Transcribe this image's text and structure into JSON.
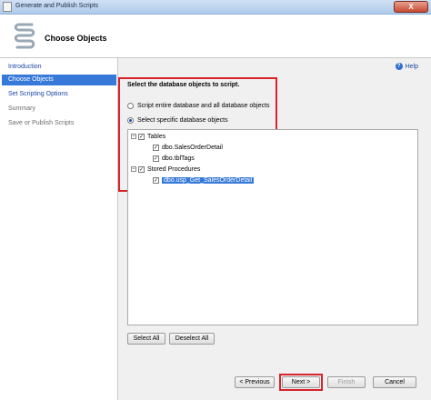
{
  "window": {
    "title": "Generate and Publish Scripts",
    "close_symbol": "X"
  },
  "header": {
    "page_title": "Choose Objects"
  },
  "sidebar": {
    "items": [
      {
        "label": "Introduction",
        "state": "link"
      },
      {
        "label": "Choose Objects",
        "state": "selected"
      },
      {
        "label": "Set Scripting Options",
        "state": "link"
      },
      {
        "label": "Summary",
        "state": "disabled"
      },
      {
        "label": "Save or Publish Scripts",
        "state": "disabled"
      }
    ]
  },
  "main": {
    "help_label": "Help",
    "help_icon_glyph": "?",
    "prompt": "Select the database objects to script.",
    "options": [
      {
        "label": "Script entire database and all database objects",
        "selected": false
      },
      {
        "label": "Select specific database objects",
        "selected": true
      }
    ],
    "tree": {
      "nodes": [
        {
          "label": "Tables",
          "toggle": "−",
          "check": "✓"
        },
        {
          "label": "dbo.SalesOrderDetail",
          "check": "✓"
        },
        {
          "label": "dbo.tblTags",
          "check": "✓"
        },
        {
          "label": "Stored Procedures",
          "toggle": "−",
          "check": "✓"
        },
        {
          "label": "dbo.usp_Get_SalesOrderDetail",
          "check": "✓"
        }
      ]
    },
    "select_all_label": "Select All",
    "deselect_all_label": "Deselect All"
  },
  "footer": {
    "previous_label": "< Previous",
    "next_label": "Next >",
    "finish_label": "Finish",
    "cancel_label": "Cancel"
  },
  "colors": {
    "highlight_red": "#d8232a",
    "selection_blue": "#3679d8",
    "link_blue": "#1c46a6"
  }
}
